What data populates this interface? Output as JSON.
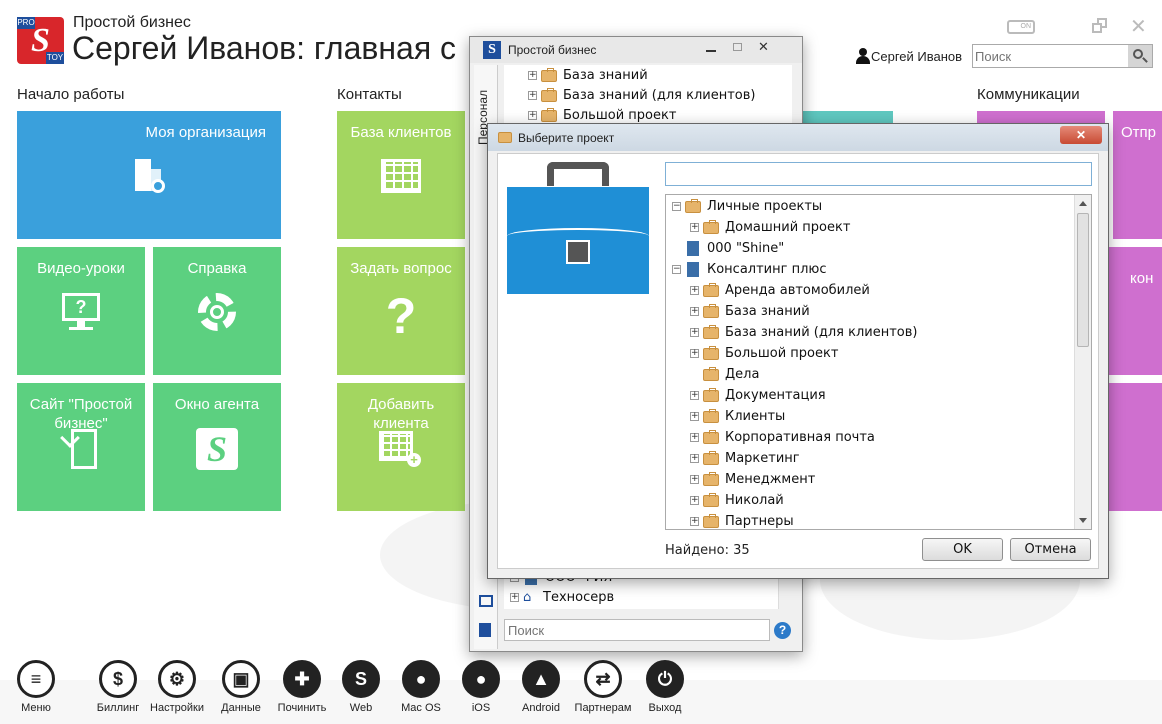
{
  "app": {
    "brand": "Простой бизнес",
    "logo_top": "PRO",
    "logo_bottom": "TOY",
    "title": "Сергей Иванов: главная с",
    "user_name": "Сергей Иванов",
    "search_placeholder": "Поиск",
    "online_badge": "ON"
  },
  "sections": {
    "start": "Начало работы",
    "contacts": "Контакты",
    "comms": "Коммуникации"
  },
  "tiles": {
    "my_org": "Моя организация",
    "video": "Видео-уроки",
    "help": "Справка",
    "site": "Сайт \"Простой бизнес\"",
    "agent": "Окно агента",
    "clients_db": "База клиентов",
    "ask": "Задать вопрос",
    "add_client": "Добавить клиента",
    "send_partial": "Отпр",
    "conf_partial": "кон"
  },
  "bottom_bar": [
    "Меню",
    "Биллинг",
    "Настройки",
    "Данные",
    "Починить",
    "Web",
    "Mac OS",
    "iOS",
    "Android",
    "Партнерам",
    "Выход"
  ],
  "back_window": {
    "title": "Простой бизнес",
    "vertical_tab": "Персонал",
    "top_items": [
      "База знаний",
      "База знаний (для клиентов)",
      "Большой проект"
    ],
    "bottom_items": [
      "ООО \"РИЯ\"",
      "Техносерв"
    ],
    "search_placeholder": "Поиск",
    "help_glyph": "?"
  },
  "dialog": {
    "title": "Выберите проект",
    "close_glyph": "✕",
    "filter_value": "",
    "found_label": "Найдено: 35",
    "ok_label": "OK",
    "cancel_label": "Отмена",
    "tree": [
      {
        "label": "Личные проекты",
        "level": 0,
        "expander": "minus",
        "icon": "folder"
      },
      {
        "label": "Домашний проект",
        "level": 1,
        "expander": "plus",
        "icon": "folder"
      },
      {
        "label": "000 \"Shine\"",
        "level": 0,
        "expander": "none",
        "icon": "building"
      },
      {
        "label": "Консалтинг плюс",
        "level": 0,
        "expander": "minus",
        "icon": "building"
      },
      {
        "label": "Аренда автомобилей",
        "level": 1,
        "expander": "plus",
        "icon": "folder"
      },
      {
        "label": "База знаний",
        "level": 1,
        "expander": "plus",
        "icon": "folder"
      },
      {
        "label": "База знаний (для клиентов)",
        "level": 1,
        "expander": "plus",
        "icon": "folder"
      },
      {
        "label": "Большой проект",
        "level": 1,
        "expander": "plus",
        "icon": "folder"
      },
      {
        "label": "Дела",
        "level": 1,
        "expander": "none",
        "icon": "folder"
      },
      {
        "label": "Документация",
        "level": 1,
        "expander": "plus",
        "icon": "folder"
      },
      {
        "label": "Клиенты",
        "level": 1,
        "expander": "plus",
        "icon": "folder"
      },
      {
        "label": "Корпоративная почта",
        "level": 1,
        "expander": "plus",
        "icon": "folder"
      },
      {
        "label": "Маркетинг",
        "level": 1,
        "expander": "plus",
        "icon": "folder"
      },
      {
        "label": "Менеджмент",
        "level": 1,
        "expander": "plus",
        "icon": "folder"
      },
      {
        "label": "Николай",
        "level": 1,
        "expander": "plus",
        "icon": "folder"
      },
      {
        "label": "Партнеры",
        "level": 1,
        "expander": "plus",
        "icon": "folder"
      }
    ]
  },
  "colors": {
    "blue_tile": "#3aa0dc",
    "green_tile": "#5cd080",
    "lime_tile": "#a3d660",
    "teal_tile": "#5fc8c0",
    "pink_tile": "#cf6fcf",
    "briefcase": "#1f8fd6"
  }
}
